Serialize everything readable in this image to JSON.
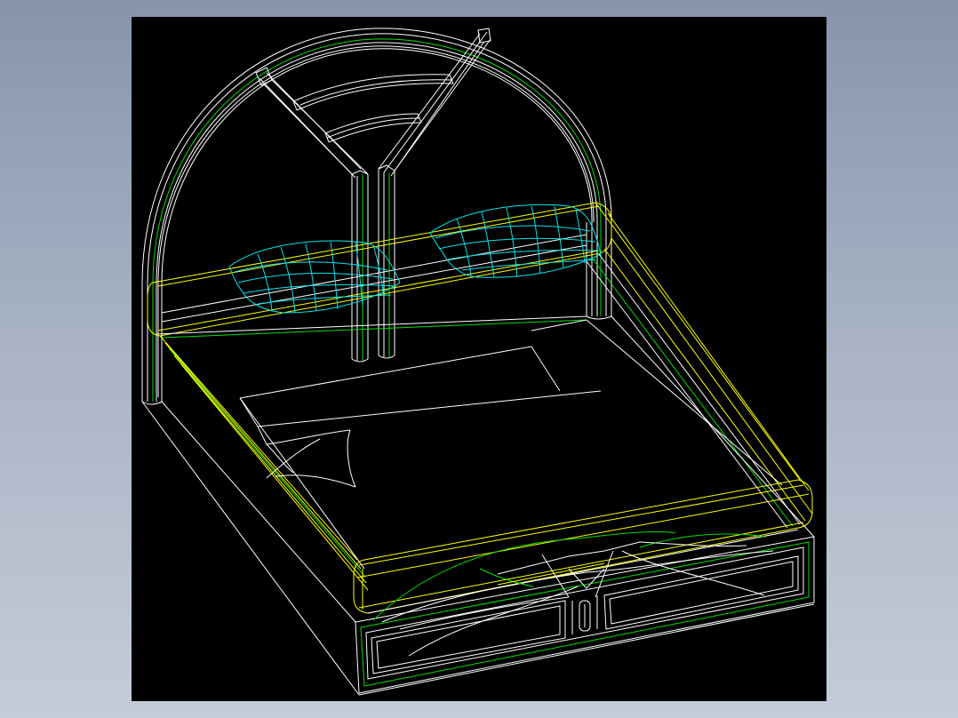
{
  "drawing": {
    "subject": "bed-wireframe",
    "colors": {
      "background": "#000000",
      "frame": "#ffffff",
      "rail": "#ffff00",
      "accent": "#00e000",
      "pillow": "#00e5ee"
    }
  }
}
